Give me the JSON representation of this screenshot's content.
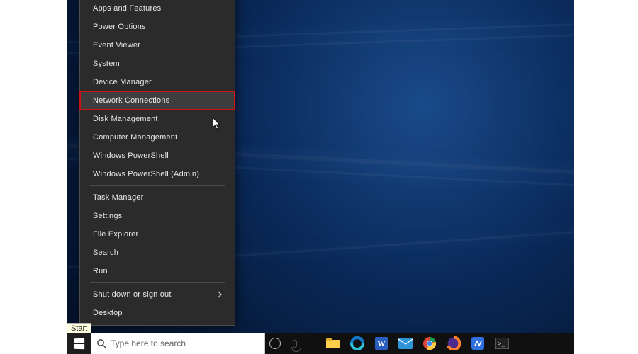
{
  "menu": {
    "items": [
      {
        "label": "Apps and Features"
      },
      {
        "label": "Power Options"
      },
      {
        "label": "Event Viewer"
      },
      {
        "label": "System"
      },
      {
        "label": "Device Manager"
      },
      {
        "label": "Network Connections",
        "highlight": true
      },
      {
        "label": "Disk Management"
      },
      {
        "label": "Computer Management"
      },
      {
        "label": "Windows PowerShell"
      },
      {
        "label": "Windows PowerShell (Admin)"
      }
    ],
    "items2": [
      {
        "label": "Task Manager"
      },
      {
        "label": "Settings"
      },
      {
        "label": "File Explorer"
      },
      {
        "label": "Search"
      },
      {
        "label": "Run"
      }
    ],
    "items3": [
      {
        "label": "Shut down or sign out",
        "submenu": true
      },
      {
        "label": "Desktop"
      }
    ]
  },
  "tooltip": {
    "text": "Start"
  },
  "taskbar": {
    "search_placeholder": "Type here to search",
    "icons": [
      {
        "name": "file-explorer-icon",
        "color": "#ffcf4a"
      },
      {
        "name": "edge-icon",
        "color": "#2a9fd6"
      },
      {
        "name": "word-icon",
        "color": "#2a5fc1"
      },
      {
        "name": "mail-icon",
        "color": "#36a0e0"
      },
      {
        "name": "chrome-icon",
        "color": "#ffffff"
      },
      {
        "name": "firefox-icon",
        "color": "#ff7f2a"
      },
      {
        "name": "app-blue-icon",
        "color": "#3aa9ff"
      },
      {
        "name": "terminal-icon",
        "color": "#cccccc"
      }
    ]
  }
}
